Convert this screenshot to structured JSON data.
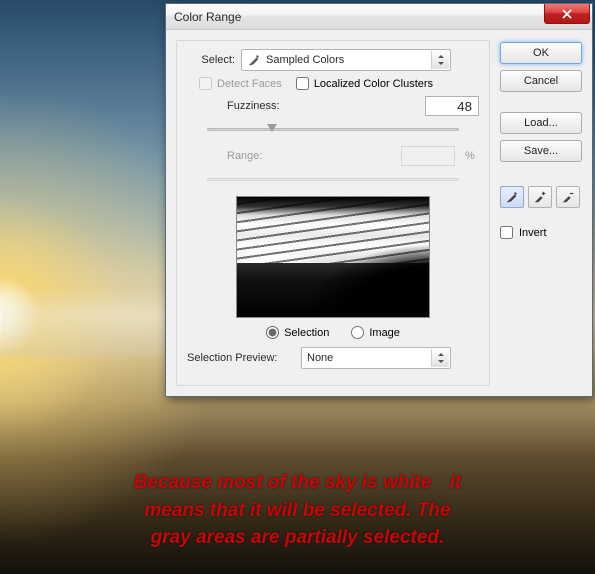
{
  "dialog": {
    "title": "Color Range",
    "select_label": "Select:",
    "select_value": "Sampled Colors",
    "detect_faces_label": "Detect Faces",
    "localized_clusters_label": "Localized Color Clusters",
    "fuzziness_label": "Fuzziness:",
    "fuzziness_value": "48",
    "fuzziness_slider_pct": 24,
    "range_label": "Range:",
    "range_value": "",
    "range_unit": "%",
    "radio_selection": "Selection",
    "radio_image": "Image",
    "selection_preview_label": "Selection Preview:",
    "selection_preview_value": "None"
  },
  "buttons": {
    "ok": "OK",
    "cancel": "Cancel",
    "load": "Load...",
    "save": "Save...",
    "invert": "Invert"
  },
  "caption": {
    "l1a": "Because most of the sky is white",
    "l1b": "it",
    "l2": "means that it will be selected. The",
    "l3": "gray areas are partially selected."
  }
}
